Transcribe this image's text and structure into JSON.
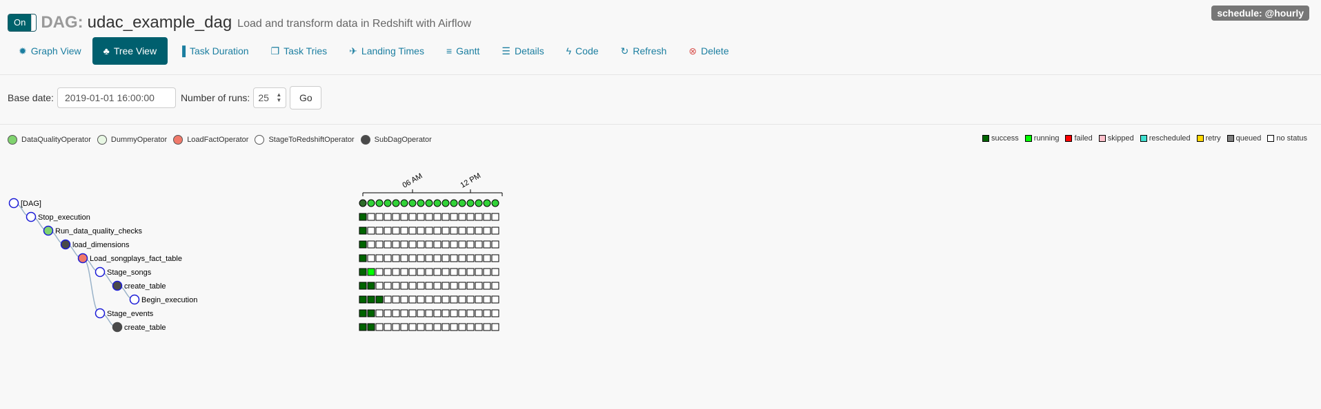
{
  "header": {
    "toggle_label": "On",
    "dag_prefix": "DAG:",
    "dag_id": "udac_example_dag",
    "description": "Load and transform data in Redshift with Airflow",
    "schedule": "schedule: @hourly"
  },
  "nav": {
    "tabs": [
      {
        "label": "Graph View",
        "icon": "graph-icon",
        "glyph": "✹"
      },
      {
        "label": "Tree View",
        "icon": "tree-icon",
        "glyph": "♣",
        "active": true
      },
      {
        "label": "Task Duration",
        "icon": "bar-chart-icon",
        "glyph": "▐"
      },
      {
        "label": "Task Tries",
        "icon": "copy-icon",
        "glyph": "❐"
      },
      {
        "label": "Landing Times",
        "icon": "plane-icon",
        "glyph": "✈"
      },
      {
        "label": "Gantt",
        "icon": "gantt-icon",
        "glyph": "≡"
      },
      {
        "label": "Details",
        "icon": "list-icon",
        "glyph": "☰"
      },
      {
        "label": "Code",
        "icon": "bolt-icon",
        "glyph": "ϟ"
      },
      {
        "label": "Refresh",
        "icon": "refresh-icon",
        "glyph": "↻"
      },
      {
        "label": "Delete",
        "icon": "delete-icon",
        "glyph": "⊗"
      }
    ]
  },
  "form": {
    "base_date_label": "Base date:",
    "base_date_value": "2019-01-01 16:00:00",
    "num_runs_label": "Number of runs:",
    "num_runs_value": "25",
    "go_label": "Go"
  },
  "operator_legend": [
    {
      "label": "DataQualityOperator",
      "color": "#80d36f"
    },
    {
      "label": "DummyOperator",
      "color": "#e8f7e4"
    },
    {
      "label": "LoadFactOperator",
      "color": "#f0796a"
    },
    {
      "label": "StageToRedshiftOperator",
      "color": "#ffffff"
    },
    {
      "label": "SubDagOperator",
      "color": "#4a4a4a"
    }
  ],
  "state_legend": [
    {
      "label": "success",
      "color": "#006400"
    },
    {
      "label": "running",
      "color": "#00ff00"
    },
    {
      "label": "failed",
      "color": "#ff0000"
    },
    {
      "label": "skipped",
      "color": "#ffc0cb"
    },
    {
      "label": "rescheduled",
      "color": "#40e0d0"
    },
    {
      "label": "retry",
      "color": "#ffd700"
    },
    {
      "label": "queued",
      "color": "#808080"
    },
    {
      "label": "no status",
      "color": "#ffffff"
    }
  ],
  "tree": {
    "time_axis_ticks": [
      "06 AM",
      "12 PM"
    ],
    "nodes": [
      {
        "label": "[DAG]",
        "depth": 0,
        "fill": "#ffffff",
        "stroke": "#1a1ad6"
      },
      {
        "label": "Stop_execution",
        "depth": 1,
        "fill": "#ffffff",
        "stroke": "#1a1ad6"
      },
      {
        "label": "Run_data_quality_checks",
        "depth": 2,
        "fill": "#80d36f",
        "stroke": "#1a1ad6"
      },
      {
        "label": "load_dimensions",
        "depth": 3,
        "fill": "#4a4a4a",
        "stroke": "#1a1ad6"
      },
      {
        "label": "Load_songplays_fact_table",
        "depth": 4,
        "fill": "#f0796a",
        "stroke": "#1a1ad6"
      },
      {
        "label": "Stage_songs",
        "depth": 5,
        "fill": "#ffffff",
        "stroke": "#1a1ad6"
      },
      {
        "label": "create_table",
        "depth": 6,
        "fill": "#4a4a4a",
        "stroke": "#1a1ad6"
      },
      {
        "label": "Begin_execution",
        "depth": 7,
        "fill": "#ffffff",
        "stroke": "#1a1ad6"
      },
      {
        "label": "Stage_events",
        "depth": 5,
        "fill": "#ffffff",
        "stroke": "#1a1ad6"
      },
      {
        "label": "create_table",
        "depth": 6,
        "fill": "#4a4a4a",
        "stroke": "#4a4a4a"
      }
    ],
    "dag_runs": 17,
    "task_rows": [
      [
        "success"
      ],
      [
        "success"
      ],
      [
        "success"
      ],
      [
        "success"
      ],
      [
        "success",
        "running"
      ],
      [
        "success",
        "success"
      ],
      [
        "success",
        "success",
        "success"
      ],
      [
        "success",
        "success"
      ],
      [
        "success",
        "success"
      ]
    ]
  }
}
